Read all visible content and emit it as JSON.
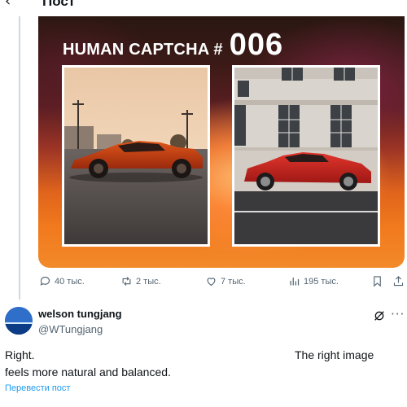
{
  "header": {
    "back_glyph": "‹",
    "title": "Пост"
  },
  "post_media": {
    "captcha_label": "HUMAN CAPTCHA #",
    "captcha_number": "006",
    "left_image": "orange-supercar-on-empty-lot-at-sunset",
    "right_image": "red-sports-car-in-front-of-stone-building"
  },
  "post_actions": {
    "replies": "40 тыс.",
    "reposts": "2 тыс.",
    "likes": "7 тыс.",
    "views": "195 тыс.",
    "icons": [
      "reply-icon",
      "repost-icon",
      "like-icon",
      "views-icon",
      "bookmark-icon",
      "share-icon"
    ]
  },
  "reply": {
    "display_name": "welson tungjang",
    "handle": "@WTungjang",
    "text_line1": "Right.",
    "text_line2": "The right image",
    "text_line3": "feels more natural and balanced.",
    "translate_label": "Перевести пост",
    "more_glyph": "···"
  },
  "colors": {
    "link": "#1d9bf0",
    "secondary_text": "#536471",
    "primary_text": "#0f1419"
  }
}
